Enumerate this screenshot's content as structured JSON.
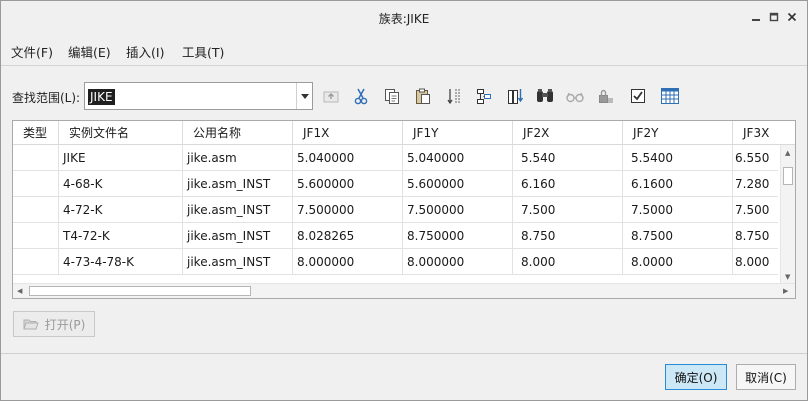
{
  "window": {
    "title": "族表:JIKE"
  },
  "menu": [
    "文件(F)",
    "编辑(E)",
    "插入(I)",
    "工具(T)"
  ],
  "search": {
    "label": "查找范围(L):",
    "value": "JIKE"
  },
  "toolbar_icons": [
    "up-level-icon",
    "cut-icon",
    "copy-icon",
    "paste-icon",
    "insert-row-icon",
    "insert-column-icon",
    "column-config-icon",
    "find-icon",
    "preview-icon",
    "lock-icon",
    "verify-icon",
    "table-icon"
  ],
  "table": {
    "columns": [
      "类型",
      "实例文件名",
      "公用名称",
      "JF1X",
      "JF1Y",
      "JF2X",
      "JF2Y",
      "JF3X"
    ],
    "rows": [
      [
        "",
        "JIKE",
        "jike.asm",
        "5.040000",
        "5.040000",
        "5.540",
        "5.5400",
        "6.550"
      ],
      [
        "",
        "4-68-K",
        "jike.asm_INST",
        "5.600000",
        "5.600000",
        "6.160",
        "6.1600",
        "7.280"
      ],
      [
        "",
        "4-72-K",
        "jike.asm_INST",
        "7.500000",
        "7.500000",
        "7.500",
        "7.5000",
        "7.500"
      ],
      [
        "",
        "T4-72-K",
        "jike.asm_INST",
        "8.028265",
        "8.750000",
        "8.750",
        "8.7500",
        "8.750"
      ],
      [
        "",
        "4-73-4-78-K",
        "jike.asm_INST",
        "8.000000",
        "8.000000",
        "8.000",
        "8.0000",
        "8.000"
      ]
    ]
  },
  "buttons": {
    "open": "打开(P)",
    "ok": "确定(O)",
    "cancel": "取消(C)"
  }
}
